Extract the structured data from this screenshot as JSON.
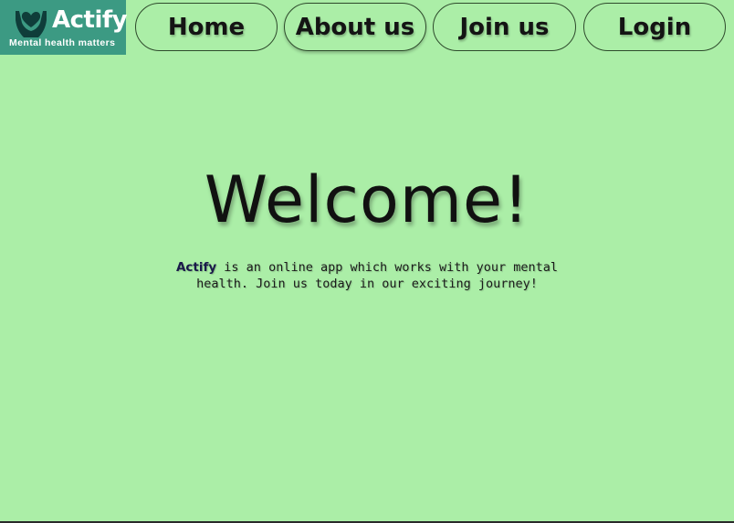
{
  "logo": {
    "name": "Actify",
    "tagline": "Mental health matters",
    "icon": "hands-heart-icon",
    "background_color": "#3c9a83"
  },
  "nav": {
    "items": [
      {
        "label": "Home"
      },
      {
        "label": "About us"
      },
      {
        "label": "Join us"
      },
      {
        "label": "Login"
      }
    ]
  },
  "main": {
    "heading": "Welcome!",
    "intro_brand": "Actify",
    "intro_text": " is an online app which works with your mental health. Join us today in our exciting journey!"
  },
  "colors": {
    "page_background": "#abeea7",
    "text": "#111111"
  }
}
